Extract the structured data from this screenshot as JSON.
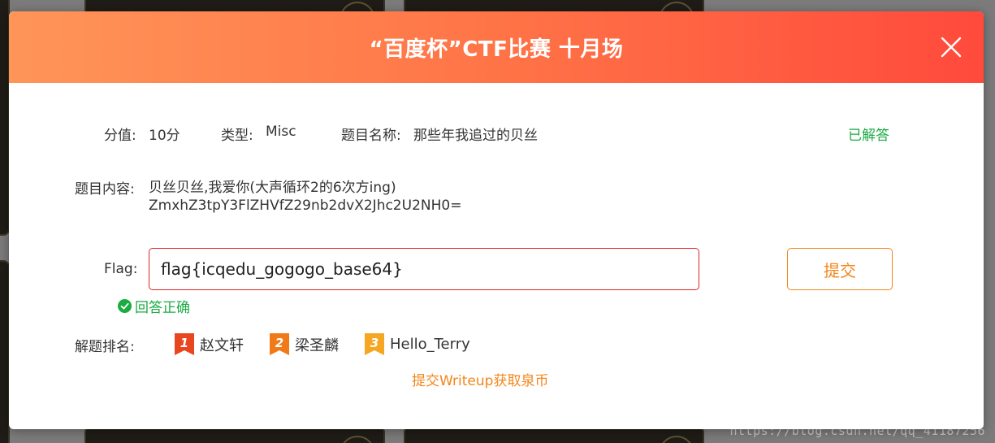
{
  "modal": {
    "title": "“百度杯”CTF比赛 十月场"
  },
  "challenge": {
    "score_label": "分值:",
    "score_value": "10分",
    "type_label": "类型:",
    "type_value": "Misc",
    "name_label": "题目名称:",
    "name_value": "那些年我追过的贝丝",
    "status": "已解答",
    "content_label": "题目内容:",
    "content_line1": "贝丝贝丝,我爱你(大声循环2的6次方ing)",
    "content_line2": "ZmxhZ3tpY3FlZHVfZ29nb2dvX2Jhc2U2NH0="
  },
  "flag": {
    "label": "Flag:",
    "value": "flag{icqedu_gogogo_base64}",
    "submit_label": "提交",
    "result": "回答正确"
  },
  "ranking": {
    "label": "解题排名:",
    "entries": [
      {
        "medal": "1",
        "name": "赵文轩"
      },
      {
        "medal": "2",
        "name": "梁圣麟"
      },
      {
        "medal": "3",
        "name": "Hello_Terry"
      }
    ]
  },
  "writeup": {
    "link_text": "提交Writeup获取泉币"
  },
  "watermark": "https://blog.csdn.net/qq_41187256",
  "colors": {
    "header_start": "#ff9558",
    "header_end": "#ff4a3c",
    "accent_orange": "#f3861b",
    "success_green": "#1aab43",
    "input_border_red": "#e02222",
    "medal_1": "#e8461e",
    "medal_2": "#f07a1a",
    "medal_3": "#f5a623"
  }
}
